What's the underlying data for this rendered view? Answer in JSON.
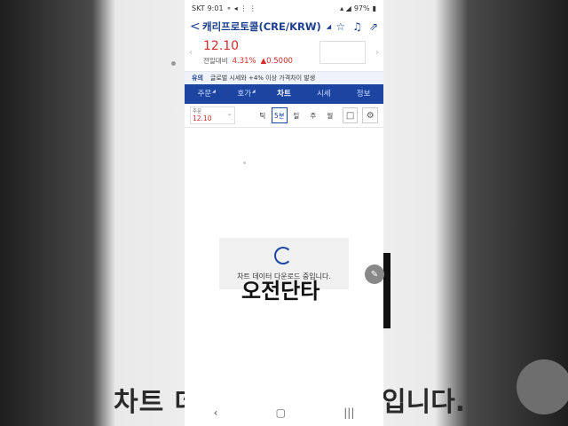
{
  "status_bar": {
    "carrier": "SKT",
    "time": "9:01",
    "battery": "97%"
  },
  "header": {
    "title": "캐리프로토콜(CRE/KRW)",
    "icons": [
      "back-icon",
      "star-icon",
      "bell-icon",
      "share-icon"
    ]
  },
  "quote": {
    "price": "12.10",
    "change_label": "전일대비",
    "change_pct": "4.31%",
    "change_value": "▲0.5000"
  },
  "notice": {
    "tag": "유의",
    "text": "글로벌 시세와 +4% 이상 가격차이 발생"
  },
  "tabs": [
    {
      "label": "주문"
    },
    {
      "label": "호가"
    },
    {
      "label": "차트"
    },
    {
      "label": "시세"
    },
    {
      "label": "정보"
    }
  ],
  "active_tab": "차트",
  "toolbar": {
    "order_label": "주문",
    "order_value": "12.10",
    "periods": [
      "틱",
      "5분",
      "일",
      "주",
      "월"
    ],
    "active_period": "5분"
  },
  "loading": {
    "text": "차트 데이터 다운로드 중입니다."
  },
  "overlay_caption": "오전단타",
  "background_caption_left": "차트 데",
  "background_caption_right": "입니다.",
  "colors": {
    "brand_blue": "#1b45a1",
    "up_red": "#d62b2b"
  }
}
